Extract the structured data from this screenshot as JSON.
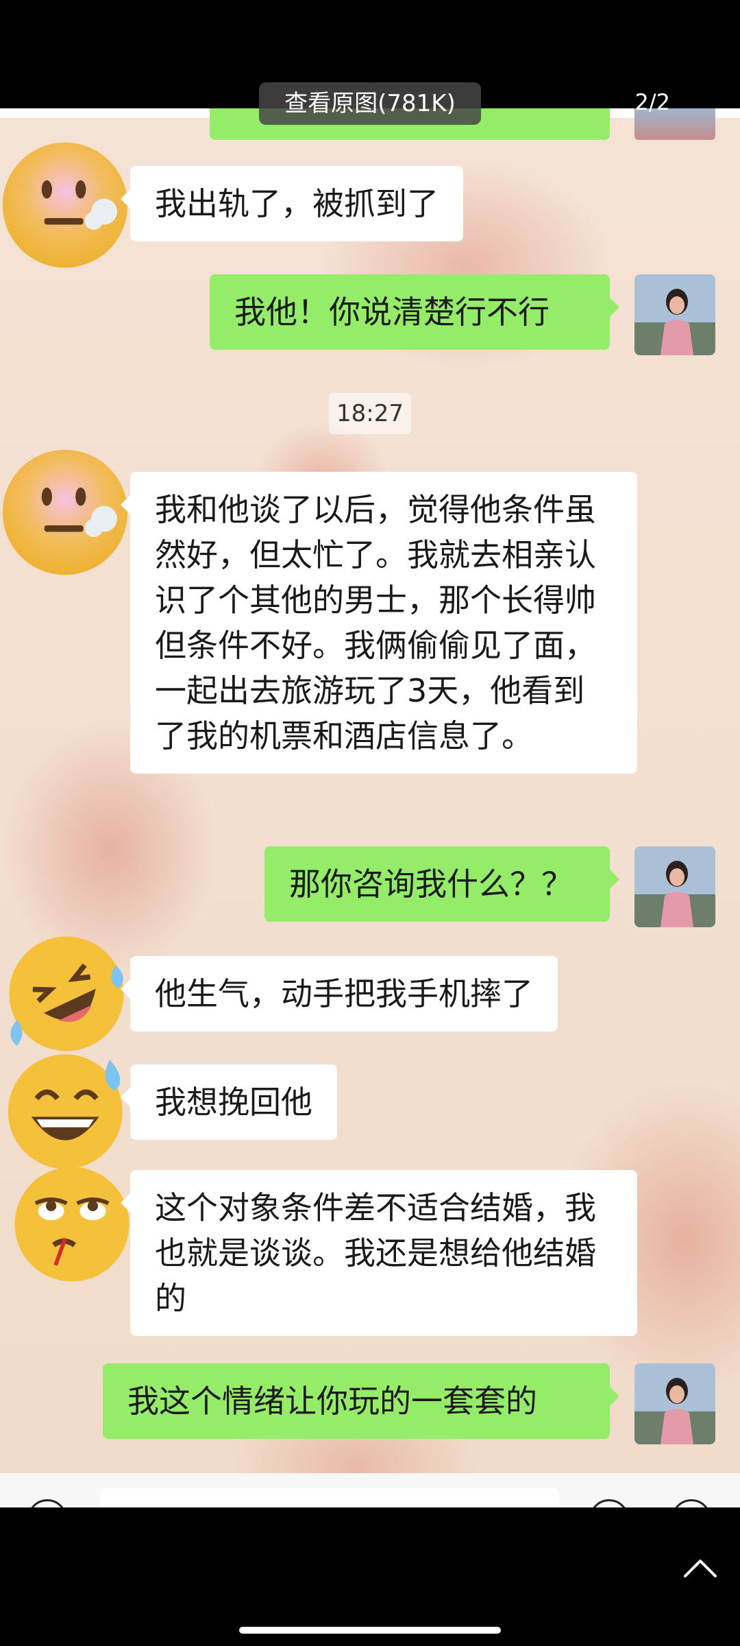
{
  "viewer": {
    "view_original_label": "查看原图(781K)",
    "page_indicator": "2/2"
  },
  "chat": {
    "timestamp": "18:27",
    "messages": [
      {
        "side": "left",
        "avatar": "face-exhaling-emoji",
        "text": "我出轨了，被抓到了"
      },
      {
        "side": "right",
        "avatar": "user-photo",
        "text": "我他！你说清楚行不行"
      },
      {
        "side": "left",
        "avatar": "face-exhaling-emoji",
        "text": "我和他谈了以后，觉得他条件虽然好，但太忙了。我就去相亲认识了个其他的男士，那个长得帅但条件不好。我俩偷偷见了面，一起出去旅游玩了3天，他看到了我的机票和酒店信息了。"
      },
      {
        "side": "right",
        "avatar": "user-photo",
        "text": "那你咨询我什么？？"
      },
      {
        "side": "left",
        "avatar": "rolling-laughing-emoji",
        "text": "他生气，动手把我手机摔了"
      },
      {
        "side": "left",
        "avatar": "grinning-sweat-emoji",
        "text": "我想挽回他"
      },
      {
        "side": "left",
        "avatar": "eye-roll-bleeding-emoji",
        "text": "这个对象条件差不适合结婚，我也就是谈谈。我还是想给他结婚的"
      },
      {
        "side": "right",
        "avatar": "user-photo",
        "text": "我这个情绪让你玩的一套套的"
      }
    ]
  },
  "icons": {
    "collapse": "chevron-up-icon"
  }
}
